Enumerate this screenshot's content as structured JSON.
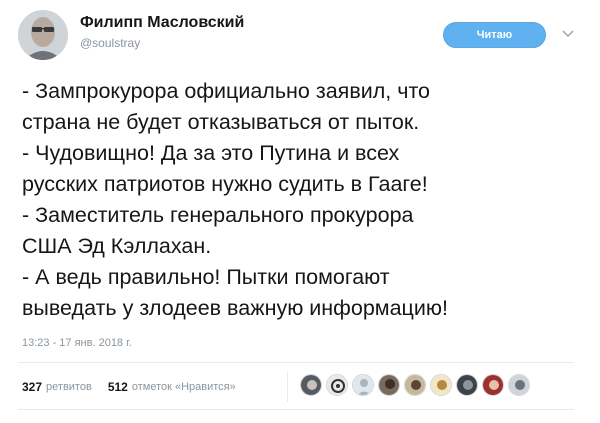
{
  "tweet": {
    "author": {
      "display_name": "Филипп Масловский",
      "username": "@soulstray"
    },
    "follow_button_label": "Читаю",
    "lines": [
      "- Зампрокурора официально заявил, что",
      "страна не будет отказываться от пыток.",
      "- Чудовищно! Да за это Путина и всех",
      "русских патриотов нужно судить в Гааге!",
      "- Заместитель генерального прокурора",
      "США Эд Кэллахан.",
      "- А ведь правильно! Пытки помогают",
      "выведать у злодеев важную информацию!"
    ],
    "timestamp": "13:23 - 17 янв. 2018 г.",
    "stats": {
      "retweets_count": "327",
      "retweets_label": "ретвитов",
      "likes_count": "512",
      "likes_label": "отметок «Нравится»"
    },
    "liker_avatar_count": 9
  },
  "colors": {
    "follow_button": "#5fb1ef",
    "text": "#14171a",
    "muted": "#8a959e",
    "divider": "#e6ecf0"
  },
  "icons": {
    "more": "chevron-down-icon"
  }
}
